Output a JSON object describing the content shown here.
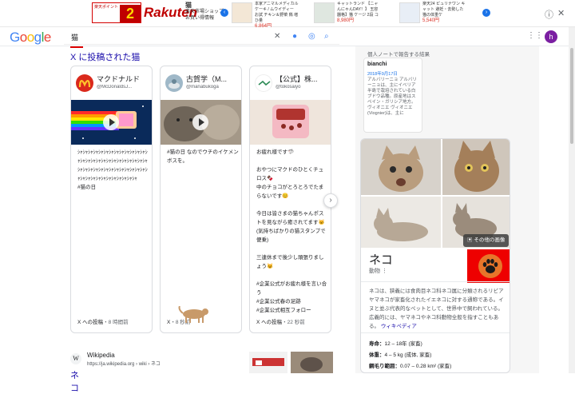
{
  "ad": {
    "promo_text": "楽天ポイント",
    "promo_big": "2倍",
    "brand": "Rakuten",
    "shop_title": "猫",
    "shop_sub": "楽天市場ショップ",
    "shop_sub2": "お買い得情報",
    "items": [
      {
        "text": "本家アニマルメディカルケーキ / ムウイディー お試 チキン＆野菜 鶏 増ひ量",
        "price": "6,864円"
      },
      {
        "text": "キャットランド 【ニャんにゃんDAY！】 玉容器格】猫 ケージ 2段 コ",
        "price": "8,980円"
      },
      {
        "text": "楽天24 ピュリナワン キャット 避妊・去勢した猫の体重ケ",
        "price": "5,540円"
      }
    ]
  },
  "search": {
    "logo": "Google",
    "query": "猫",
    "avatar_letter": "h"
  },
  "x_section": {
    "heading": "X に投稿された猫",
    "cards": [
      {
        "name": "マクドナルド",
        "handle": "@McDonaldsJ...",
        "text": "ｼｬｼｬｼｬｼｬｼｬｼｬｼｬｼｬｼｬｼｬｼｬｼｬｼｬｼｬｼｬｼｬｼｬｼｬｼｬｼｬｼｬｼｬｼｬｼｬｼｬｼｬｼｬｼｬｼｬｼｬｼｬｼｬｼｬｼｬｼｬｼｬｼｬｼｬｼｬｼｬｼｬｼｬｼｬｼｬｼｬｼｬｼｬｼｬｼｬｼｬｼｬｼｬ\n#猫の日",
        "source": "X への投稿",
        "time": "・8 時間前"
      },
      {
        "name": "古賀学（M...",
        "handle": "@manabukoga",
        "text": "#猫の日 なのでウチのイケメンボスを。",
        "source": "X",
        "time": "・8 秒前"
      },
      {
        "name": "【公式】株...",
        "handle": "@tokosaiyo",
        "text": "お疲れ様です🦈\n\nおやつにマクドのひとくチュロス🍫\n中のチョコがとろとろでたまらないです😊\n\n今日は皆さまの猫ちゃんポストを見ながら癒されてます🐱(気持ちばかりの猫スタンプで便乗)\n\n三連休まで後少し頑張りましょう😺\n\n#企業公式がお疲れ様を言い合う\n#企業公式春の足跡\n#企業公式相互フォロー",
        "source": "X への投稿",
        "time": "・22 秒前"
      }
    ]
  },
  "wiki": {
    "name": "Wikipedia",
    "url": "https://ja.wikipedia.org › wiki › ネコ",
    "title": "ネコ"
  },
  "notes": {
    "title": "個人ノートで報告する結果",
    "card_title": "bianchi",
    "card_date": "2018年9月17日",
    "card_text": "アルバリーニョ アルバリーニョは、主にイベリア半島で栽培されている白ブドウ品種。原産地はスペイン・ガリシア地方。ヴィオニエ ヴィオニエ(Viognier)は、主に"
  },
  "knowledge_panel": {
    "more_images": "その他の画像",
    "title": "ネコ",
    "subtitle": "動物",
    "description": "ネコは、狭義には食肉目ネコ科ネコ属に分類されるリビアヤマネコが家畜化されたイエネコに対する通称である。イヌと並ぶ代表的なペットとして、世界中で飼われている。広義的には、ヤマネコやネコ科動物全般を指すこともある。",
    "desc_link": "ウィキペディア",
    "facts": [
      {
        "label": "寿命：",
        "value": "12 – 18年 (家畜)"
      },
      {
        "label": "体重：",
        "value": "4 – 5 kg (成体, 家畜)"
      },
      {
        "label": "鋼毛り範囲：",
        "value": "0.07 – 0.28 km² (家畜)"
      }
    ]
  }
}
